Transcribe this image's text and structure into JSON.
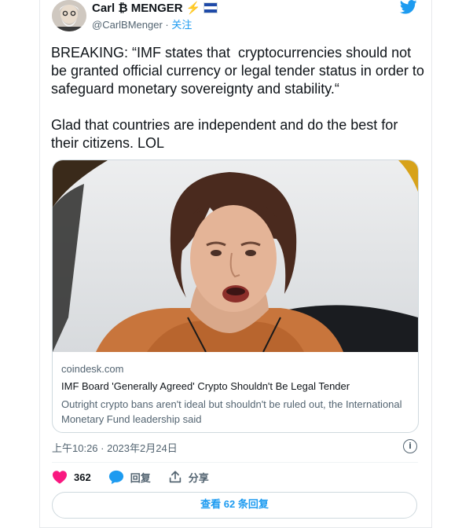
{
  "author": {
    "name": "Carl ₿ MENGER",
    "handle": "@CarlBMenger",
    "follow_label": "关注",
    "separator": " · "
  },
  "tweet": {
    "paragraph_1": "BREAKING: “IMF states that  cryptocurrencies should not be granted official currency or legal tender status in order to safeguard monetary sovereignty and stability.“",
    "paragraph_2": "Glad that countries are independent and do the best for their citizens. LOL"
  },
  "link_card": {
    "domain": "coindesk.com",
    "title": "IMF Board 'Generally Agreed' Crypto Shouldn't Be Legal Tender",
    "description": "Outright crypto bans aren't ideal but shouldn't be ruled out, the International Monetary Fund leadership said"
  },
  "timestamp": "上午10:26 · 2023年2月24日",
  "info_glyph": "i",
  "actions": {
    "like_count": "362",
    "reply_label": "回复",
    "share_label": "分享"
  },
  "view_replies_label": "查看 62 条回复",
  "colors": {
    "accent": "#1d9bf0",
    "like": "#f91880",
    "text": "#0f1419",
    "muted": "#536471"
  }
}
